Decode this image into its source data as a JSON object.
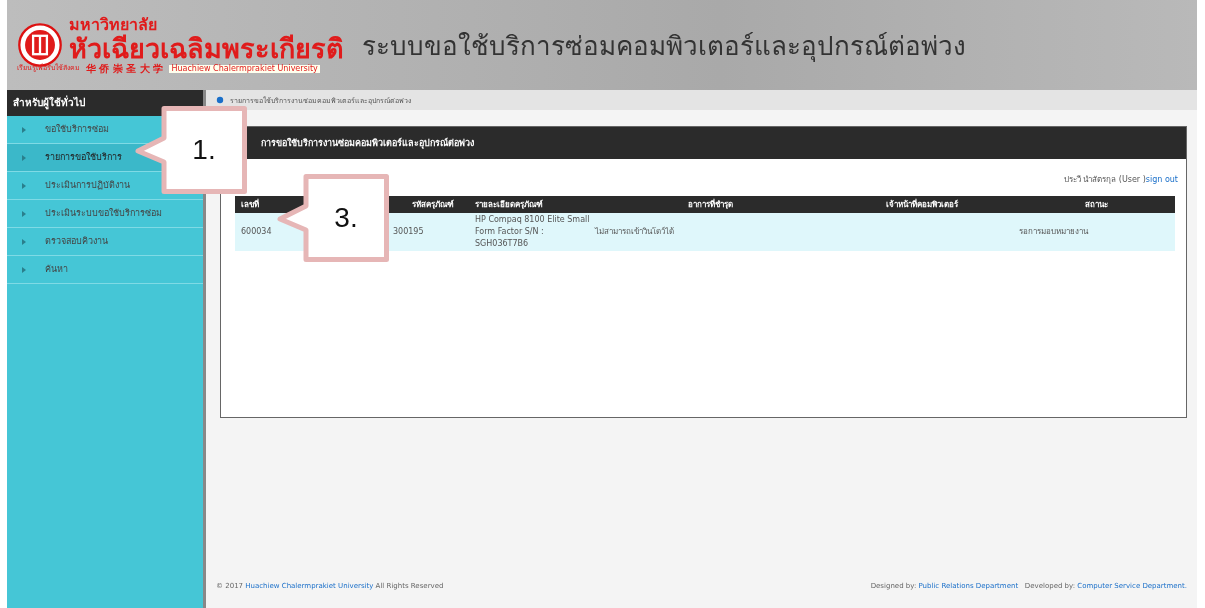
{
  "header": {
    "university_thai_small": "มหาวิทยาลัย",
    "university_thai": "หัวเฉียวเฉลิมพระเกียรติ",
    "logo_caption": "เรียนรู้เพื่อรับใช้สังคม",
    "university_chinese": "华 侨 崇 圣 大 学",
    "university_english": "Huachiew Chalermprakiet University",
    "system_title": "ระบบขอใช้บริการซ่อมคอมพิวเตอร์และอุปกรณ์ต่อพ่วง"
  },
  "sidebar": {
    "title": "สำหรับผู้ใช้ทั่วไป",
    "items": [
      {
        "label": "ขอใช้บริการซ่อม",
        "selected": false
      },
      {
        "label": "รายการขอใช้บริการ",
        "selected": true
      },
      {
        "label": "ประเมินการปฏิบัติงาน",
        "selected": false
      },
      {
        "label": "ประเมินระบบขอใช้บริการซ่อม",
        "selected": false
      },
      {
        "label": "ตรวจสอบคิวงาน",
        "selected": false
      },
      {
        "label": "ค้นหา",
        "selected": false
      }
    ]
  },
  "breadcrumb": "รายการขอใช้บริการงานซ่อมคอมพิวเตอร์และอุปกรณ์ต่อพ่วง",
  "panel": {
    "title": "การขอใช้บริการงานซ่อมคอมพิวเตอร์และอุปกรณ์ต่อพ่วง",
    "user": "ประวี นำสัตรกุล  (User )",
    "sign_out": "sign out",
    "table": {
      "columns": [
        "เลขที่",
        "",
        "รหัสครุภัณฑ์",
        "รายละเอียดครุภัณฑ์",
        "อาการที่ชำรุด",
        "เจ้าหน้าที่คอมพิวเตอร์",
        "สถานะ"
      ],
      "rows": [
        [
          "600034",
          "",
          "300195",
          "HP Compaq 8100 Elite Small Form Factor S/N : SGH036T7B6",
          "ไม่สามารถเข้าวินโดว์ได้",
          "",
          "รอการมอบหมายงาน"
        ]
      ]
    }
  },
  "footer": {
    "copyright": "© 2017",
    "university_link": "Huachiew Chalermprakiet University",
    "rights": "All Rights Reserved",
    "designed_by": "Designed by:",
    "designer_link": "Public Relations Department",
    "developed_by": "Developed by:",
    "developer_link": "Computer Service Department."
  },
  "callouts": [
    {
      "label": "1."
    },
    {
      "label": "3."
    }
  ]
}
